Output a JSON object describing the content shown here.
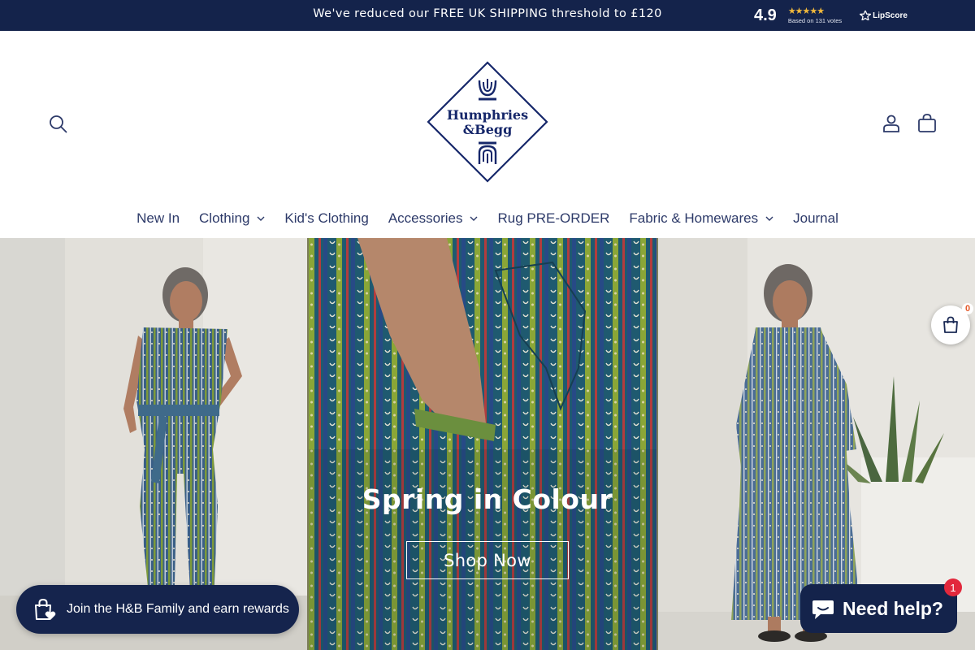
{
  "announcement": {
    "text": "We've reduced our FREE UK SHIPPING threshold to £120",
    "rating_score": "4.9",
    "rating_stars": "★★★★★",
    "rating_votes": "Based on 131 votes",
    "rating_provider": "LipScore"
  },
  "header": {
    "logo_text_line1": "Humphries",
    "logo_text_line2": "&Begg",
    "icons": {
      "search": "search-icon",
      "account": "account-icon",
      "cart": "cart-icon"
    }
  },
  "nav": {
    "items": [
      {
        "label": "New In",
        "has_dropdown": false
      },
      {
        "label": "Clothing",
        "has_dropdown": true
      },
      {
        "label": "Kid's Clothing",
        "has_dropdown": false
      },
      {
        "label": "Accessories",
        "has_dropdown": true
      },
      {
        "label": "Rug PRE-ORDER",
        "has_dropdown": false
      },
      {
        "label": "Fabric & Homewares",
        "has_dropdown": true
      },
      {
        "label": "Journal",
        "has_dropdown": false
      }
    ]
  },
  "hero": {
    "title": "Spring in Colour",
    "button_label": "Shop Now"
  },
  "widgets": {
    "rewards_label": "Join the H&B Family and earn rewards",
    "cart_count": "0",
    "help_label": "Need help?",
    "help_badge": "1"
  },
  "colors": {
    "brand_navy": "#14234b",
    "star_gold": "#f0b83c",
    "badge_red": "#e2283c"
  }
}
